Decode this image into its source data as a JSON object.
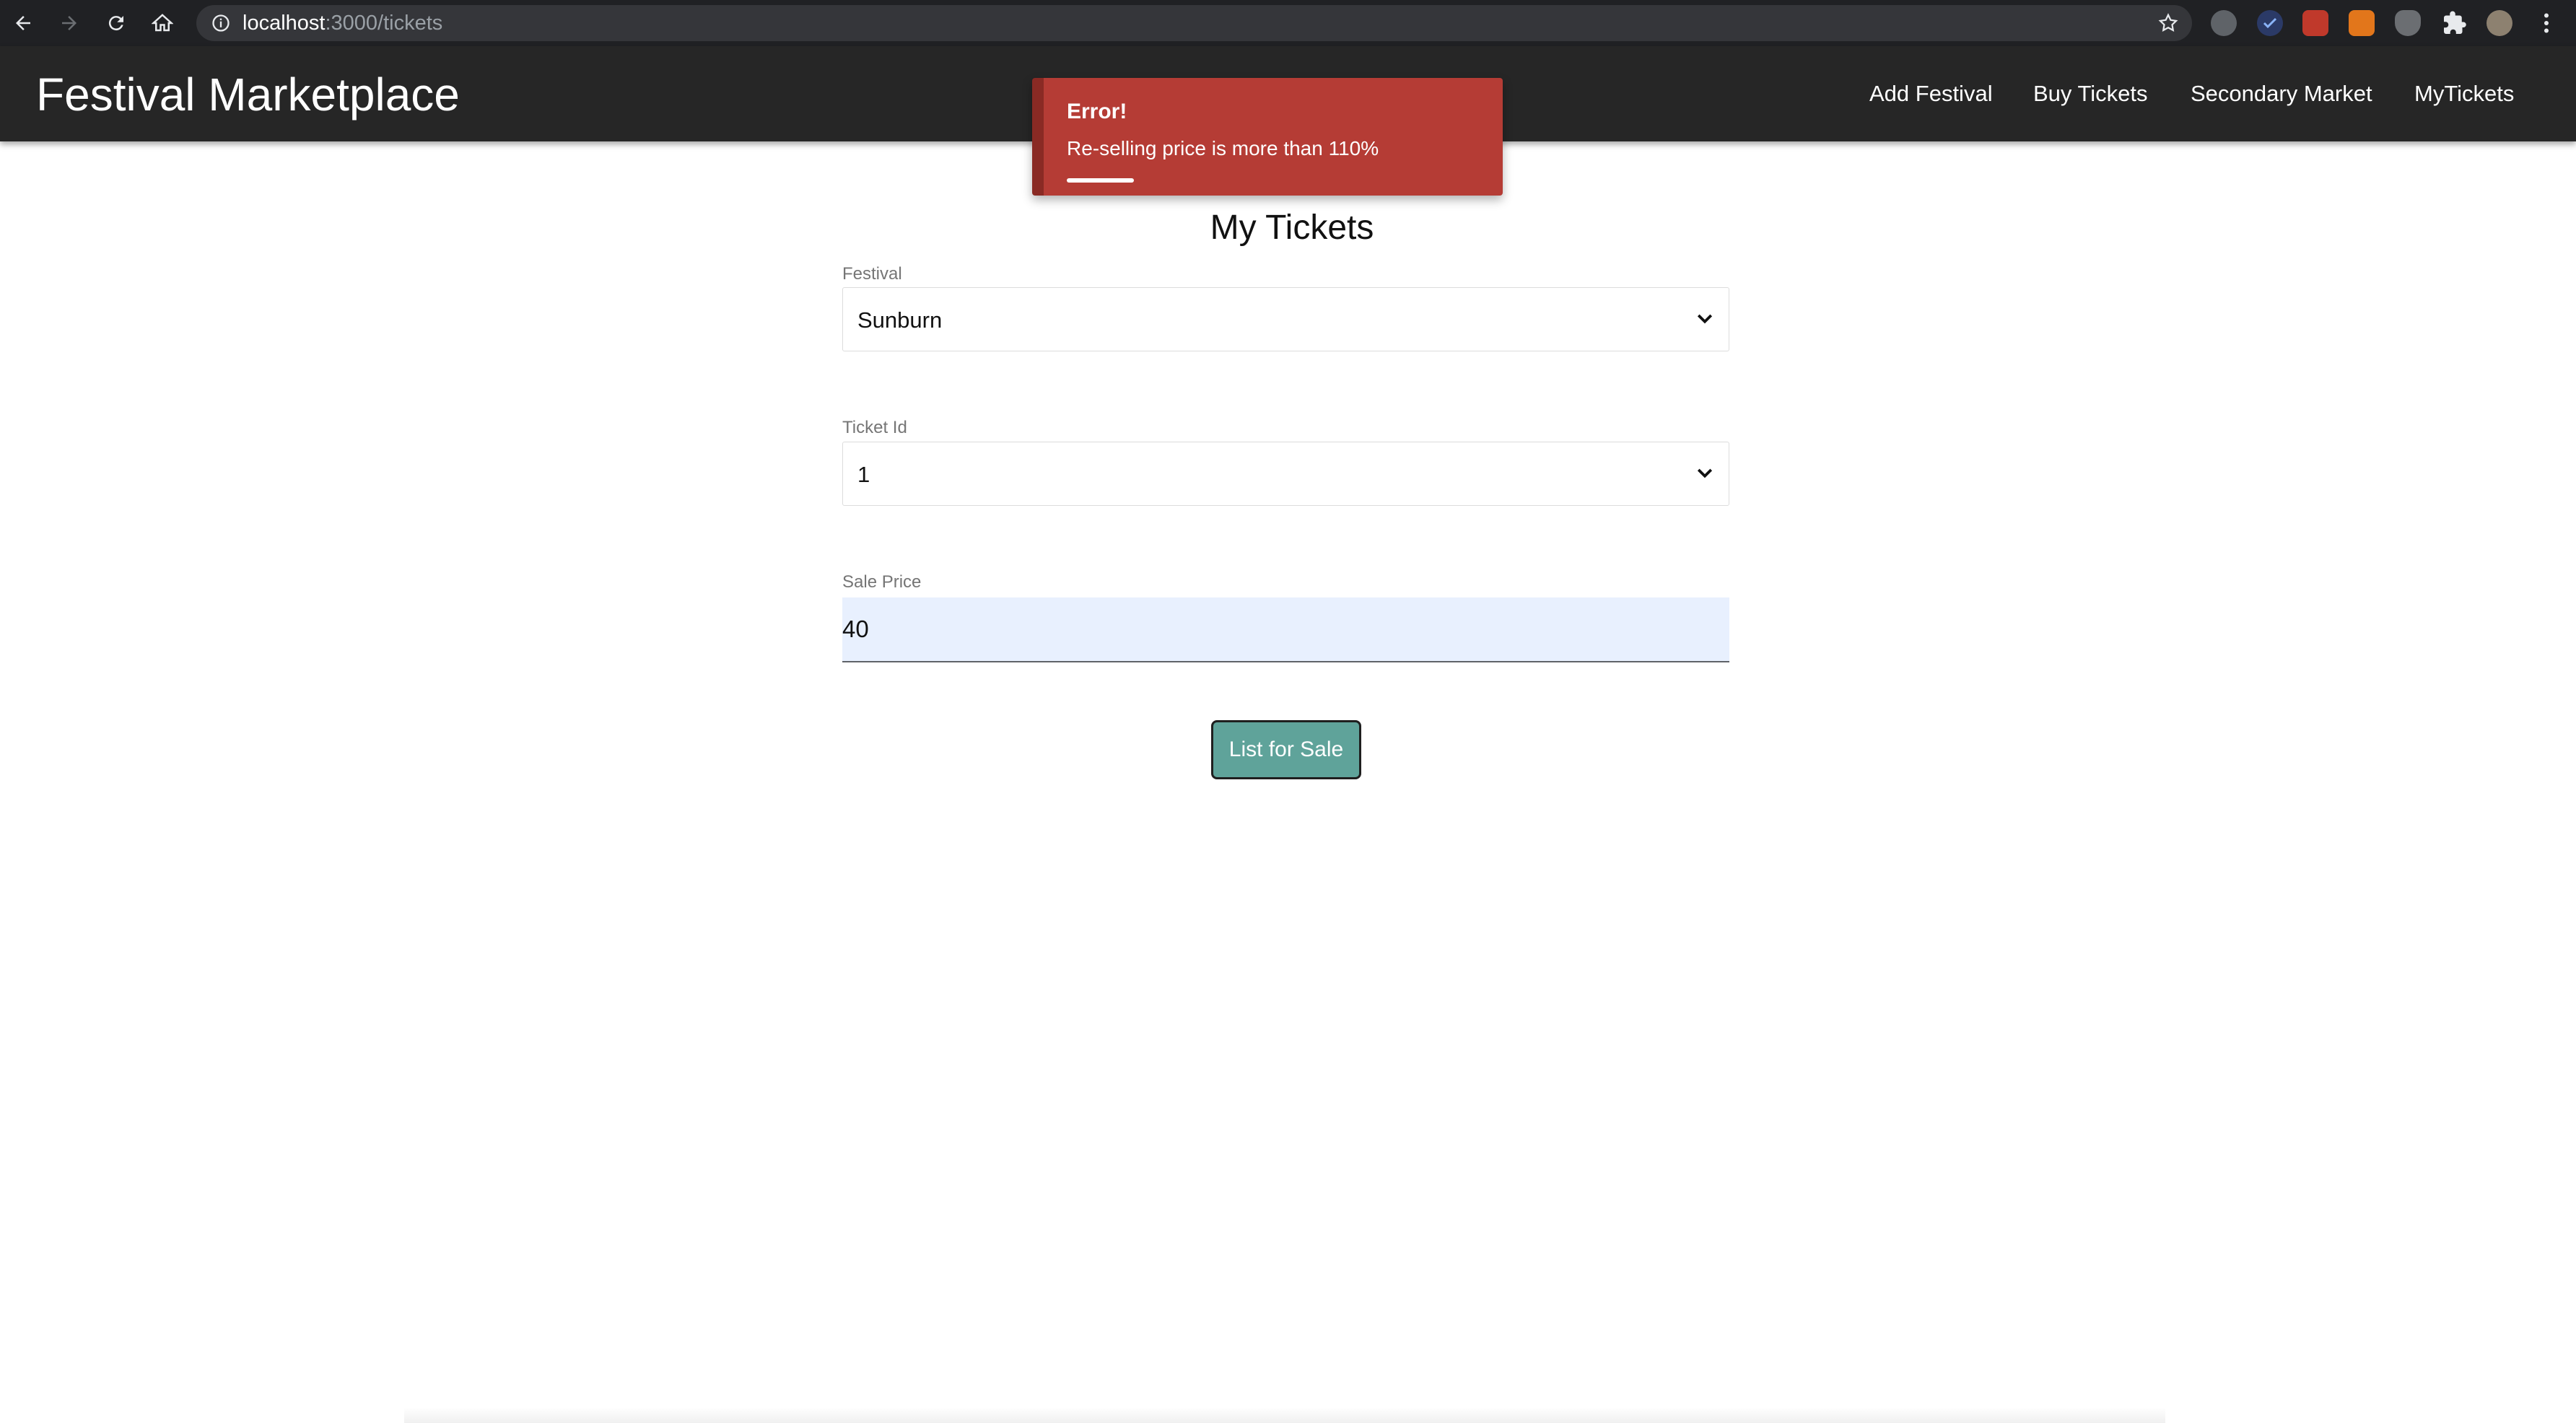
{
  "browser": {
    "url_host": "localhost",
    "url_path": ":3000/tickets",
    "icons": [
      "back-arrow-icon",
      "forward-arrow-icon",
      "reload-icon",
      "home-icon",
      "info-icon",
      "star-icon",
      "extensions-icon",
      "menu-icon"
    ]
  },
  "navbar": {
    "brand": "Festival Marketplace",
    "links": [
      {
        "label": "Add Festival"
      },
      {
        "label": "Buy Tickets"
      },
      {
        "label": "Secondary Market"
      },
      {
        "label": "MyTickets"
      }
    ]
  },
  "toast": {
    "title": "Error!",
    "message": "Re-selling price is more than 110%",
    "progress_percent": 16,
    "color": "#b53c35"
  },
  "form": {
    "title": "My Tickets",
    "festival": {
      "label": "Festival",
      "value": "Sunburn"
    },
    "ticket_id": {
      "label": "Ticket Id",
      "value": "1"
    },
    "sale_price": {
      "label": "Sale Price",
      "value": "40"
    },
    "submit_label": "List for Sale",
    "submit_color": "#5fa39a"
  }
}
